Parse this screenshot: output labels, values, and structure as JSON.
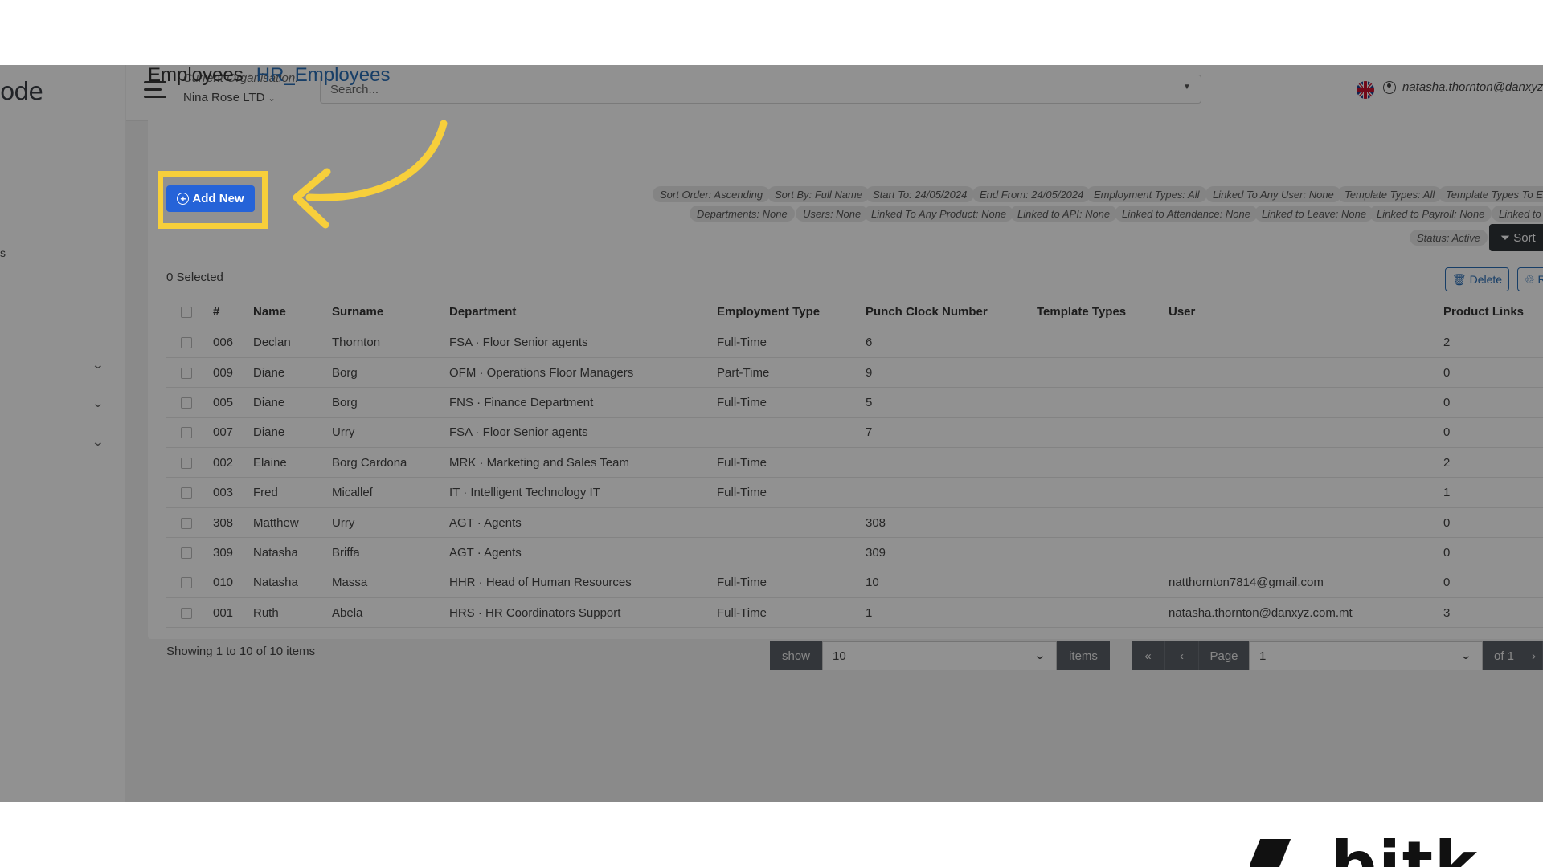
{
  "sidebar": {
    "logo_text": "ode",
    "partial_item": "s"
  },
  "header": {
    "org_label": "Current Organisation:",
    "org_value": "Nina Rose LTD",
    "search_placeholder": "Search...",
    "user_email": "natasha.thornton@danxyz.com.mt",
    "language_icon": "uk-flag-icon"
  },
  "breadcrumb": {
    "section": "Employees",
    "separator": "·",
    "current": "HR_Employees"
  },
  "toolbar": {
    "add_new_label": "Add New",
    "sort_label": "Sort",
    "delete_label": "Delete",
    "restore_label": "R"
  },
  "filters": {
    "row1": [
      "Sort Order: Ascending",
      "Sort By: Full Name",
      "Start To: 24/05/2024",
      "End From: 24/05/2024",
      "Employment Types: All",
      "Linked To Any User: None",
      "Template Types: All",
      "Template Types To Exclude"
    ],
    "row2": [
      "Departments: None",
      "Users: None",
      "Linked To Any Product: None",
      "Linked to API: None",
      "Linked to Attendance: None",
      "Linked to Leave: None",
      "Linked to Payroll: None",
      "Linked to"
    ],
    "row3": [
      "Status: Active"
    ]
  },
  "selection": {
    "count_text": "0 Selected"
  },
  "table": {
    "headers": [
      "#",
      "Name",
      "Surname",
      "Department",
      "Employment Type",
      "Punch Clock Number",
      "Template Types",
      "User",
      "Product Links"
    ],
    "rows": [
      [
        "006",
        "Declan",
        "Thornton",
        "FSA · Floor Senior agents",
        "Full-Time",
        "6",
        "",
        "",
        "2"
      ],
      [
        "009",
        "Diane",
        "Borg",
        "OFM · Operations Floor Managers",
        "Part-Time",
        "9",
        "",
        "",
        "0"
      ],
      [
        "005",
        "Diane",
        "Borg",
        "FNS · Finance Department",
        "Full-Time",
        "5",
        "",
        "",
        "0"
      ],
      [
        "007",
        "Diane",
        "Urry",
        "FSA · Floor Senior agents",
        "",
        "7",
        "",
        "",
        "0"
      ],
      [
        "002",
        "Elaine",
        "Borg Cardona",
        "MRK · Marketing and Sales Team",
        "Full-Time",
        "",
        "",
        "",
        "2"
      ],
      [
        "003",
        "Fred",
        "Micallef",
        "IT · Intelligent Technology IT",
        "Full-Time",
        "",
        "",
        "",
        "1"
      ],
      [
        "308",
        "Matthew",
        "Urry",
        "AGT · Agents",
        "",
        "308",
        "",
        "",
        "0"
      ],
      [
        "309",
        "Natasha",
        "Briffa",
        "AGT · Agents",
        "",
        "309",
        "",
        "",
        "0"
      ],
      [
        "010",
        "Natasha",
        "Massa",
        "HHR · Head of Human Resources",
        "Full-Time",
        "10",
        "",
        "natthornton7814@gmail.com",
        "0"
      ],
      [
        "001",
        "Ruth",
        "Abela",
        "HRS · HR Coordinators Support",
        "Full-Time",
        "1",
        "",
        "natasha.thornton@danxyz.com.mt",
        "3"
      ]
    ]
  },
  "pagination": {
    "showing_text": "Showing 1 to 10 of 10 items",
    "show_label": "show",
    "page_size": "10",
    "items_label": "items",
    "first_icon": "«",
    "prev_icon": "‹",
    "page_label": "Page",
    "page_value": "1",
    "of_label": "of 1",
    "next_icon": "›"
  },
  "branding": {
    "wordmark": "bitk"
  },
  "colors": {
    "accent": "#2563d8",
    "highlight": "#f7cf3b",
    "overlay": "rgba(0,0,0,0.43)"
  }
}
